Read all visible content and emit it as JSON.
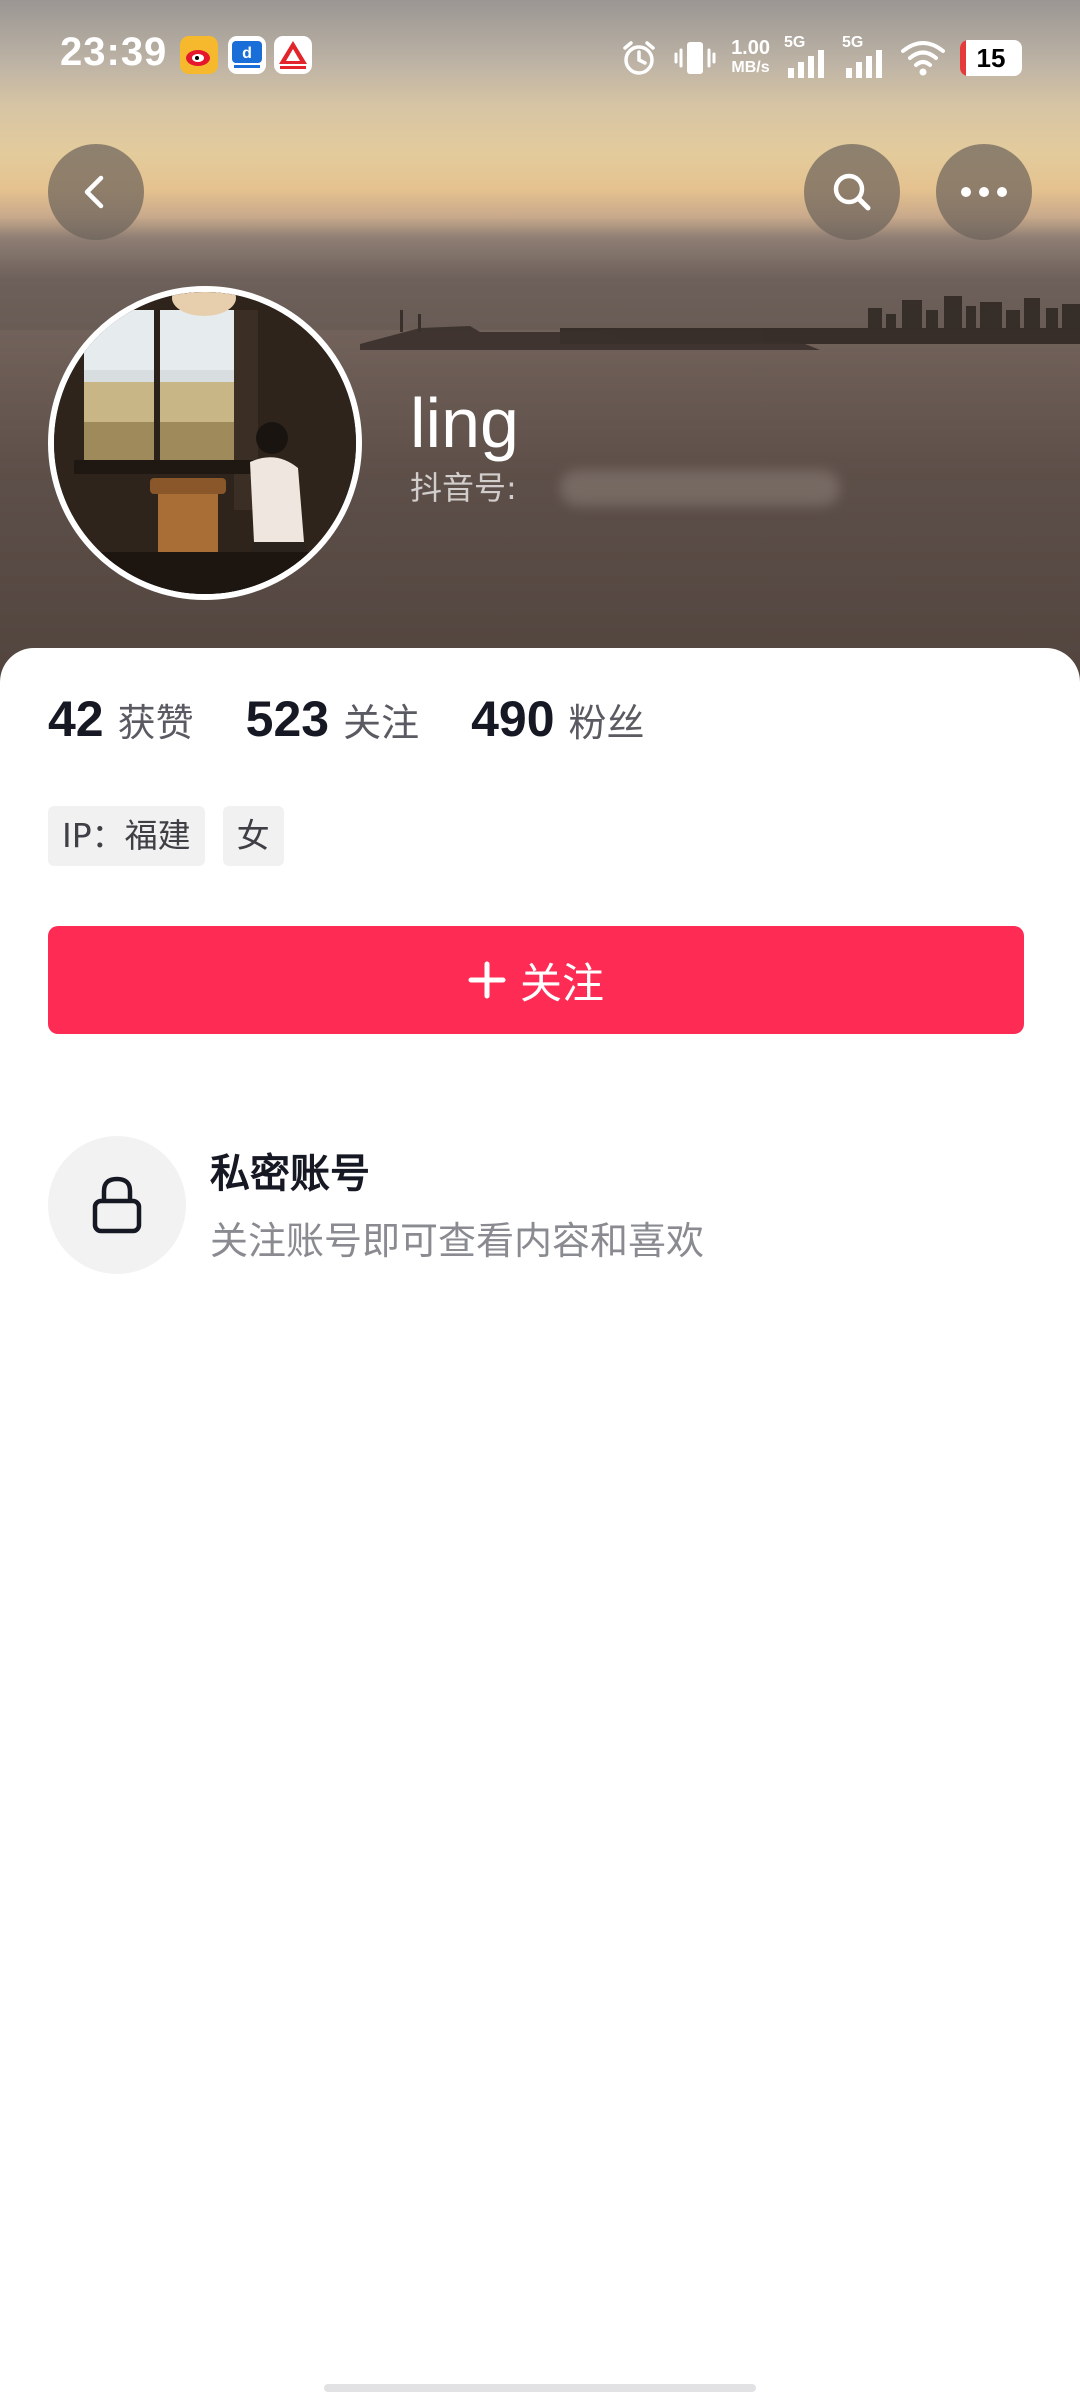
{
  "status_bar": {
    "time": "23:39",
    "net_speed_value": "1.00",
    "net_speed_unit": "MB/s",
    "signal_1": "5G",
    "signal_2": "5G",
    "battery": "15",
    "app_icons": [
      "weibo-icon",
      "news-app-icon",
      "red-app-icon"
    ]
  },
  "header": {
    "back_icon": "chevron-left-icon",
    "search_icon": "search-icon",
    "more_icon": "more-icon"
  },
  "profile": {
    "username": "ling",
    "douyin_id_label": "抖音号:"
  },
  "stats": [
    {
      "value": "42",
      "label": "获赞"
    },
    {
      "value": "523",
      "label": "关注"
    },
    {
      "value": "490",
      "label": "粉丝"
    }
  ],
  "tags": [
    "IP：福建",
    "女"
  ],
  "follow_button": {
    "label": "关注",
    "color": "#fe2c55"
  },
  "private_account": {
    "title": "私密账号",
    "description": "关注账号即可查看内容和喜欢",
    "icon": "lock-icon"
  }
}
